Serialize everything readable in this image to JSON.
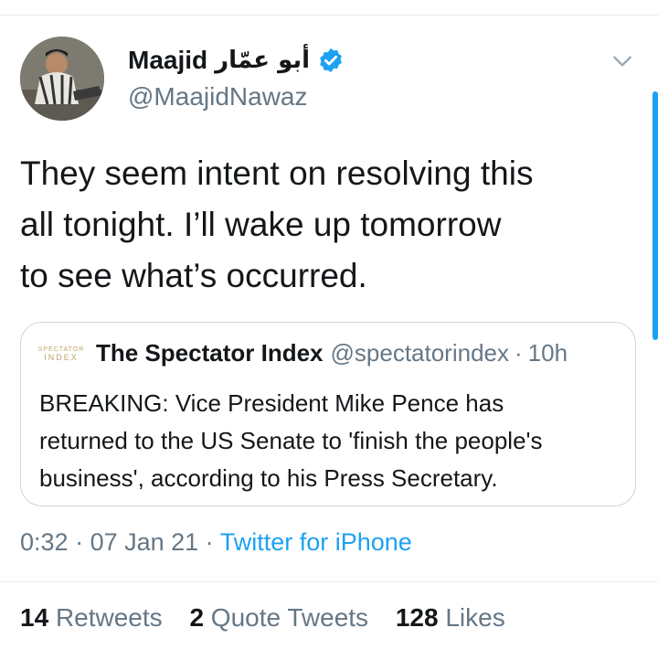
{
  "author": {
    "display_name": "Maajid",
    "arabic_name": "أبو عمّار",
    "handle": "@MaajidNawaz",
    "verified": true
  },
  "tweet": {
    "lines": [
      "They seem intent on resolving this",
      "all tonight. I’ll wake up tomorrow",
      "to see what’s occurred."
    ]
  },
  "quoted": {
    "avatar_text_top": "SPECTATOR",
    "avatar_text_bottom": "INDEX",
    "name": "The Spectator Index",
    "handle": "@spectatorindex",
    "separator": "·",
    "time": "10h",
    "lines": [
      "BREAKING: Vice President Mike Pence has",
      "returned to the US Senate to 'finish the people's",
      "business', according to his Press Secretary."
    ]
  },
  "meta": {
    "time": "0:32",
    "sep1": " · ",
    "date": "07 Jan 21",
    "sep2": " · ",
    "source": "Twitter for iPhone"
  },
  "stats": {
    "retweets": {
      "count": "14",
      "label": "Retweets"
    },
    "quotes": {
      "count": "2",
      "label": "Quote Tweets"
    },
    "likes": {
      "count": "128",
      "label": "Likes"
    }
  },
  "colors": {
    "accent": "#1da1f2",
    "secondary_text": "#657786",
    "border": "#ccd6dd"
  },
  "icons": {
    "verified": "verified-badge-icon",
    "menu": "chevron-down-icon"
  }
}
